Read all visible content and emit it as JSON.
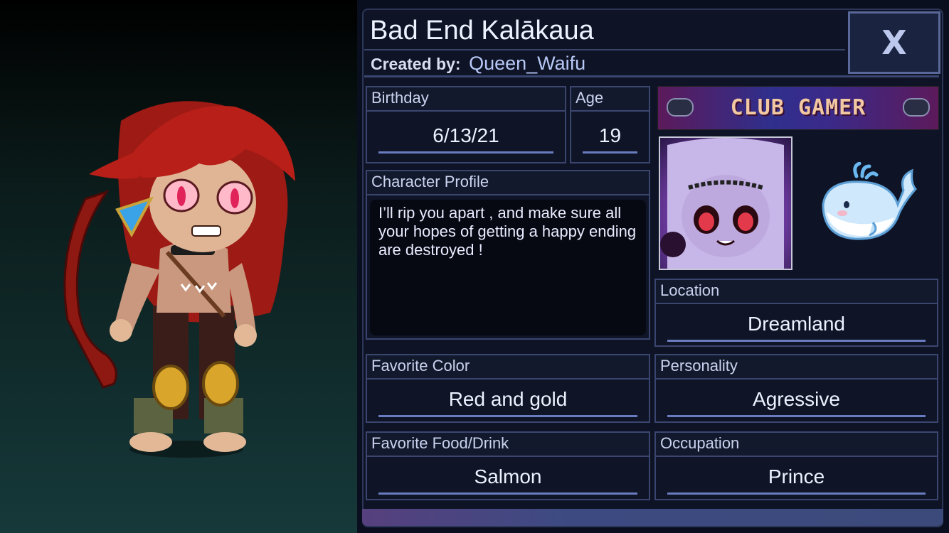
{
  "character": {
    "name": "Bad End Kalākaua",
    "created_by_label": "Created by:",
    "creator": "Queen_Waifu"
  },
  "close_button": {
    "label": "X"
  },
  "fields": {
    "birthday": {
      "label": "Birthday",
      "value": "6/13/21"
    },
    "age": {
      "label": "Age",
      "value": "19"
    },
    "profile": {
      "label": "Character Profile",
      "value": "I’ll rip you apart , and make sure all your hopes of getting a happy ending are destroyed !"
    },
    "location": {
      "label": "Location",
      "value": "Dreamland"
    },
    "favorite_color": {
      "label": "Favorite Color",
      "value": "Red and gold"
    },
    "personality": {
      "label": "Personality",
      "value": "Agressive"
    },
    "favorite_food": {
      "label": "Favorite Food/Drink",
      "value": "Salmon"
    },
    "occupation": {
      "label": "Occupation",
      "value": "Prince"
    }
  },
  "banner": {
    "text": "CLUB GAMER",
    "icon": "gamepad-icon"
  },
  "images": {
    "portrait": "character-portrait",
    "pet": "whale-icon",
    "character": "character-fullbody"
  },
  "colors": {
    "panel_bg": "#0e1426",
    "border": "#3b4670",
    "text": "#eef1ff",
    "accent": "#6a7cc0"
  }
}
